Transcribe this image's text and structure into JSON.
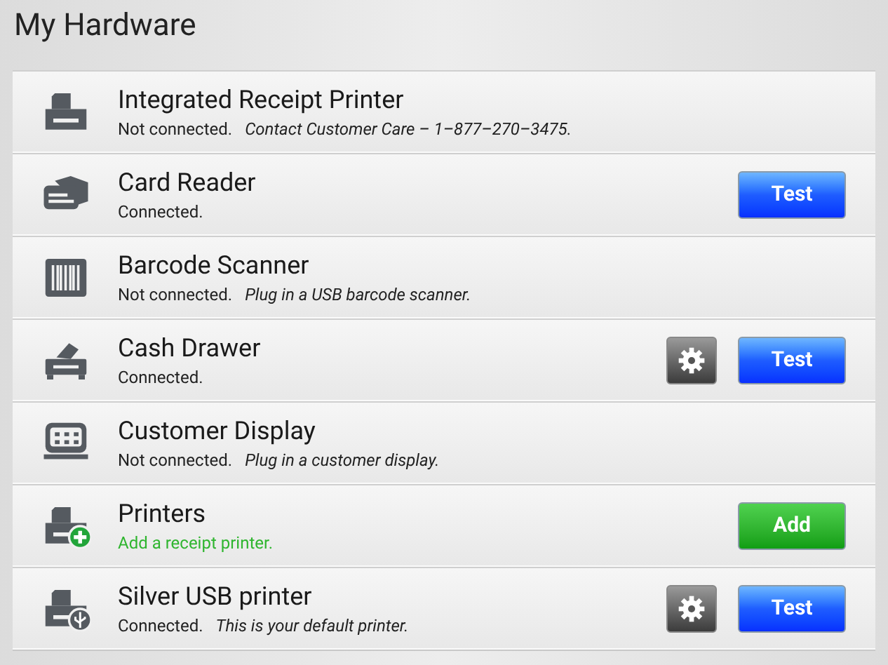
{
  "title": "My Hardware",
  "devices": [
    {
      "kind": "printer",
      "name": "Integrated Receipt Printer",
      "status": "Not connected.",
      "highlighted": false,
      "note": "Contact Customer Care – 1–877–270–3475.",
      "settings": false
    },
    {
      "kind": "card",
      "name": "Card Reader",
      "status": "Connected.",
      "highlighted": false,
      "settings": false,
      "actions": [
        {
          "kind": "test",
          "label": "Test"
        }
      ]
    },
    {
      "kind": "barcode",
      "name": "Barcode Scanner",
      "status": "Not connected.",
      "highlighted": false,
      "note": "Plug in a USB barcode scanner.",
      "settings": false
    },
    {
      "kind": "drawer",
      "name": "Cash Drawer",
      "status": "Connected.",
      "highlighted": false,
      "settings": true,
      "actions": [
        {
          "kind": "test",
          "label": "Test"
        }
      ]
    },
    {
      "kind": "display",
      "name": "Customer Display",
      "status": "Not connected.",
      "highlighted": false,
      "note": "Plug in a customer display.",
      "settings": false
    },
    {
      "kind": "printer-add",
      "name": "Printers",
      "status": "Add a receipt printer.",
      "highlighted": true,
      "settings": false,
      "actions": [
        {
          "kind": "add",
          "label": "Add"
        }
      ]
    },
    {
      "kind": "printer-usb",
      "name": "Silver USB printer",
      "status": "Connected.",
      "highlighted": false,
      "note": "This is your default printer.",
      "settings": true,
      "actions": [
        {
          "kind": "test",
          "label": "Test"
        }
      ]
    }
  ]
}
